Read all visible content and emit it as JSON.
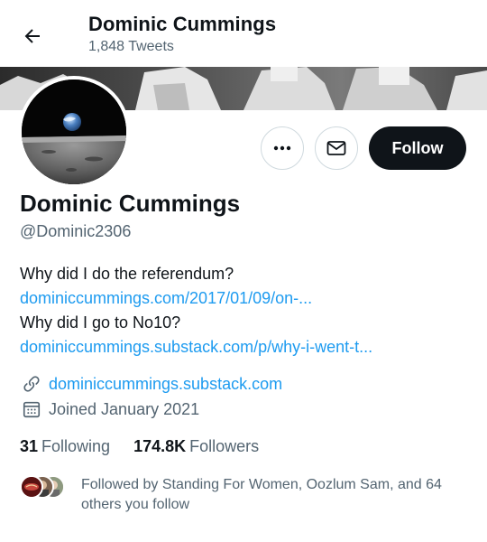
{
  "header": {
    "title": "Dominic Cummings",
    "tweet_count": "1,848 Tweets"
  },
  "profile": {
    "name": "Dominic Cummings",
    "handle": "@Dominic2306",
    "follow_label": "Follow"
  },
  "bio": {
    "line1": "Why did I do the referendum?",
    "link1": "dominiccummings.com/2017/01/09/on-...",
    "line2": "Why did I go to No10?",
    "link2": "dominiccummings.substack.com/p/why-i-went-t..."
  },
  "meta": {
    "website": "dominiccummings.substack.com",
    "joined": "Joined January 2021"
  },
  "stats": {
    "following_count": "31",
    "following_label": "Following",
    "followers_count": "174.8K",
    "followers_label": "Followers"
  },
  "followed_by": {
    "text": "Followed by Standing For Women, Oozlum Sam, and 64 others you follow"
  },
  "colors": {
    "accent": "#1d9bf0",
    "text_primary": "#0f1419",
    "text_secondary": "#536471",
    "follow_bg": "#0f1419"
  },
  "icons": [
    "back-arrow-icon",
    "more-icon",
    "mail-icon",
    "link-icon",
    "calendar-icon"
  ]
}
